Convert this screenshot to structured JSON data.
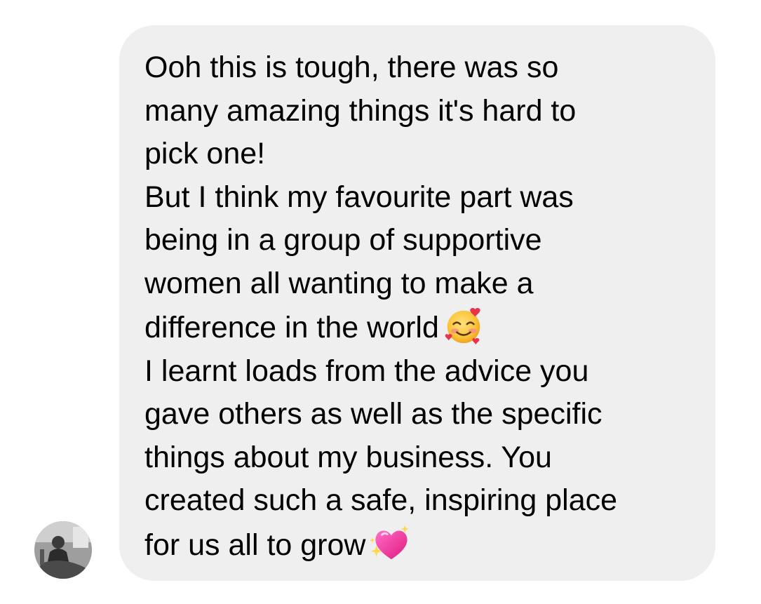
{
  "message": {
    "paragraphs": [
      {
        "lines": [
          "Ooh this is tough, there was so",
          "many amazing things it's hard to",
          "pick one!"
        ]
      },
      {
        "lines": [
          "But I think my favourite part was",
          "being in a group of supportive",
          "women all wanting to make a",
          "difference in the world"
        ],
        "trailing_emoji": "smiling-face-with-hearts-icon"
      },
      {
        "lines": [
          "I learnt loads from the advice you",
          "gave others as well as the specific",
          "things about my business. You",
          "created such a safe, inspiring place",
          "for us all to grow"
        ],
        "trailing_emoji": "sparkling-heart-icon"
      }
    ]
  },
  "colors": {
    "bubble_background": "#efefef",
    "text": "#000000",
    "page_background": "#ffffff"
  },
  "sender": {
    "avatar": "profile-photo"
  }
}
